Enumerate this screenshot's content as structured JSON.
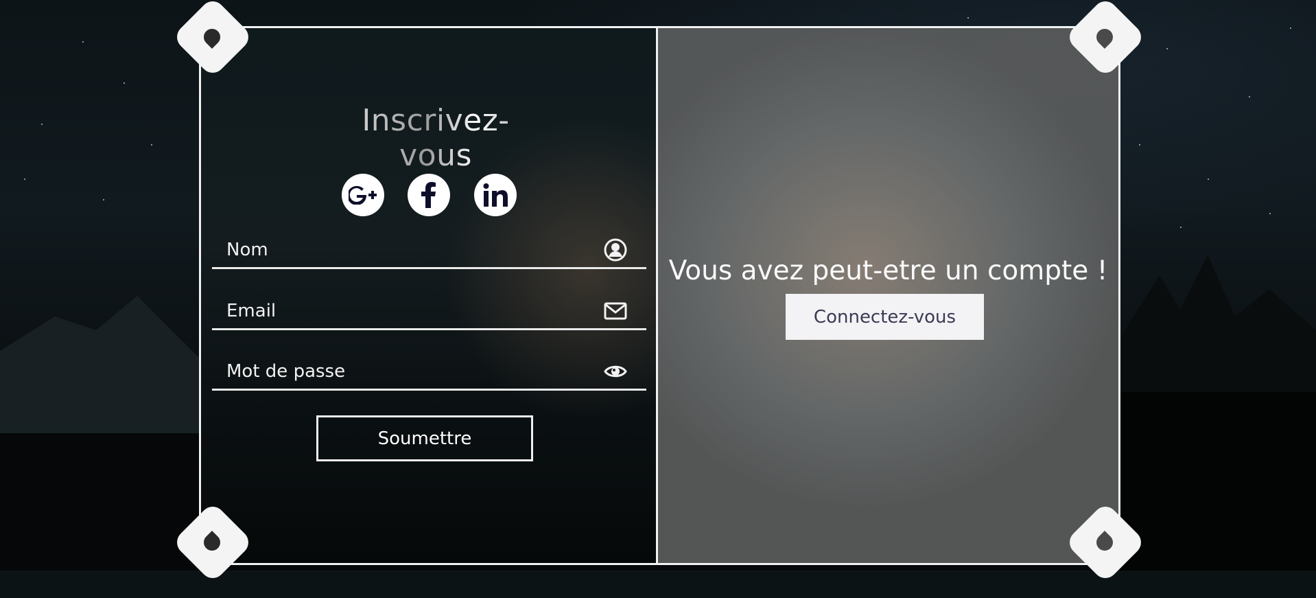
{
  "signup": {
    "title": "Inscrivez-vous",
    "social": [
      {
        "name": "google-plus-icon"
      },
      {
        "name": "facebook-icon"
      },
      {
        "name": "linkedin-icon"
      }
    ],
    "name_placeholder": "Nom",
    "email_placeholder": "Email",
    "password_placeholder": "Mot de passe",
    "submit_label": "Soumettre"
  },
  "login": {
    "prompt": "Vous avez peut-etre un compte !",
    "connect_label": "Connectez-vous"
  }
}
